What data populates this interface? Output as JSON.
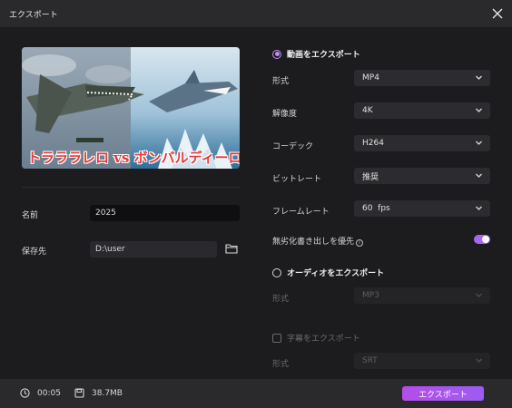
{
  "window": {
    "title": "エクスポート"
  },
  "thumbnail": {
    "caption": "トラララレロ vs ボンバルディーロ"
  },
  "left": {
    "name_label": "名前",
    "name_value": "2025",
    "save_label": "保存先",
    "save_path": "D:\\user"
  },
  "video_section": {
    "title": "動画をエクスポート",
    "rows": [
      {
        "label": "形式",
        "value": "MP4"
      },
      {
        "label": "解像度",
        "value": "4K"
      },
      {
        "label": "コーデック",
        "value": "H264"
      },
      {
        "label": "ビットレート",
        "value": "推奨"
      },
      {
        "label": "フレームレート",
        "value": "60  fps"
      }
    ],
    "lossless_label": "無劣化書き出しを優先",
    "lossless_on": true
  },
  "audio_section": {
    "title": "オーディオをエクスポート",
    "format_label": "形式",
    "format_value": "MP3"
  },
  "subtitle_section": {
    "title": "字幕をエクスポート",
    "format_label": "形式",
    "format_value": "SRT"
  },
  "footer": {
    "duration": "00:05",
    "size": "38.7MB",
    "export_label": "エクスポート"
  },
  "colors": {
    "accent": "#a866f0",
    "button": "#b54de8"
  }
}
